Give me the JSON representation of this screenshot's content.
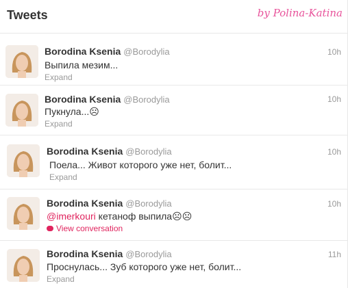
{
  "header": {
    "title": "Tweets",
    "watermark": "by Polina-Katina"
  },
  "tweets": [
    {
      "name": "Borodina Ksenia",
      "handle": "@Borodylia",
      "time": "10h",
      "text": "Выпила мезим...",
      "footer": "Expand"
    },
    {
      "name": "Borodina Ksenia",
      "handle": "@Borodylia",
      "time": "10h",
      "text": "Пукнула...☹",
      "footer": "Expand"
    },
    {
      "name": "Borodina Ksenia",
      "handle": "@Borodylia",
      "time": "10h",
      "text": "Поела... Живот которого уже нет, болит...",
      "footer": "Expand"
    },
    {
      "name": "Borodina Ksenia",
      "handle": "@Borodylia",
      "time": "10h",
      "mention": "@imerkouri",
      "text": " кетаноф выпила☹☹",
      "footer": "View conversation"
    },
    {
      "name": "Borodina Ksenia",
      "handle": "@Borodylia",
      "time": "11h",
      "text": "Проснулась... Зуб которого уже нет, болит...",
      "footer": "Expand"
    }
  ],
  "colors": {
    "accent": "#e0245e",
    "watermark": "#e8539b",
    "muted": "#999999"
  },
  "icons": {
    "conversation": "speech-bubble-icon"
  }
}
